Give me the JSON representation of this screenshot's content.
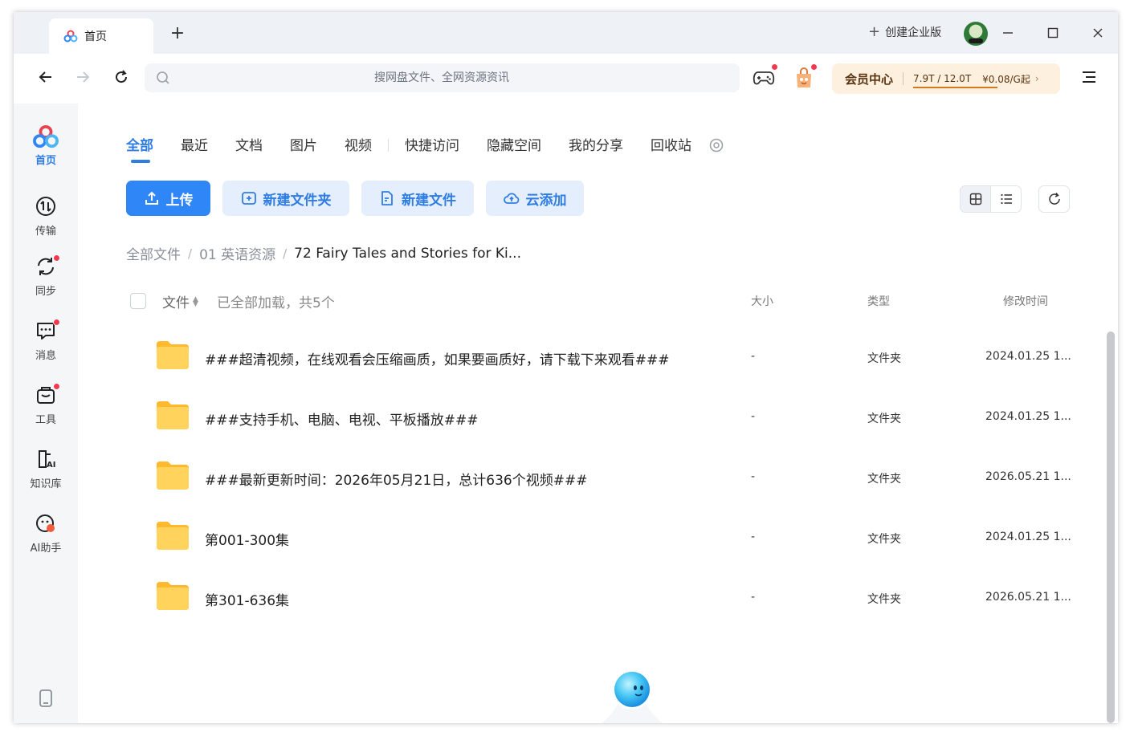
{
  "titlebar": {
    "tab_label": "首页",
    "new_tab_label": "+",
    "enterprise_label": "创建企业版"
  },
  "toolbar": {
    "search_placeholder": "搜网盘文件、全网资源资讯",
    "vip": {
      "title": "会员中心",
      "storage": "7.9T / 12.0T",
      "price": "¥0.08/G起",
      "chevron": "›"
    }
  },
  "sidebar": {
    "items": [
      {
        "label": "首页",
        "icon": "home-logo-icon",
        "active": true,
        "badge": false
      },
      {
        "label": "传输",
        "icon": "transfer-icon",
        "active": false,
        "badge": false
      },
      {
        "label": "同步",
        "icon": "sync-icon",
        "active": false,
        "badge": true
      },
      {
        "label": "消息",
        "icon": "message-icon",
        "active": false,
        "badge": true
      },
      {
        "label": "工具",
        "icon": "toolbox-icon",
        "active": false,
        "badge": true
      },
      {
        "label": "知识库",
        "icon": "knowledge-ai-icon",
        "active": false,
        "badge": false
      },
      {
        "label": "AI助手",
        "icon": "ai-assistant-icon",
        "active": false,
        "badge": false
      }
    ]
  },
  "category_tabs": [
    "全部",
    "最近",
    "文档",
    "图片",
    "视频",
    "快捷访问",
    "隐藏空间",
    "我的分享",
    "回收站"
  ],
  "actions": {
    "upload": "上传",
    "new_folder": "新建文件夹",
    "new_file": "新建文件",
    "cloud_add": "云添加"
  },
  "breadcrumb": [
    "全部文件",
    "01 英语资源",
    "72 Fairy Tales and Stories for Ki..."
  ],
  "list_header": {
    "file": "文件",
    "count": "已全部加载，共5个",
    "size": "大小",
    "type": "类型",
    "modified": "修改时间"
  },
  "files": [
    {
      "name": "###超清视频，在线观看会压缩画质，如果要画质好，请下载下来观看###",
      "size": "-",
      "type": "文件夹",
      "modified": "2024.01.25 1..."
    },
    {
      "name": "###支持手机、电脑、电视、平板播放###",
      "size": "-",
      "type": "文件夹",
      "modified": "2024.01.25 1..."
    },
    {
      "name": "###最新更新时间：2026年05月21日，总计636个视频###",
      "size": "-",
      "type": "文件夹",
      "modified": "2026.05.21 1..."
    },
    {
      "name": "第001-300集",
      "size": "-",
      "type": "文件夹",
      "modified": "2024.01.25 1..."
    },
    {
      "name": "第301-636集",
      "size": "-",
      "type": "文件夹",
      "modified": "2026.05.21 1..."
    }
  ],
  "colors": {
    "accent": "#2f7de1",
    "primary_button": "#2f86f6",
    "folder": "#ffc83d",
    "badge": "#f5384e",
    "vip_bg": "#fdf0de"
  }
}
